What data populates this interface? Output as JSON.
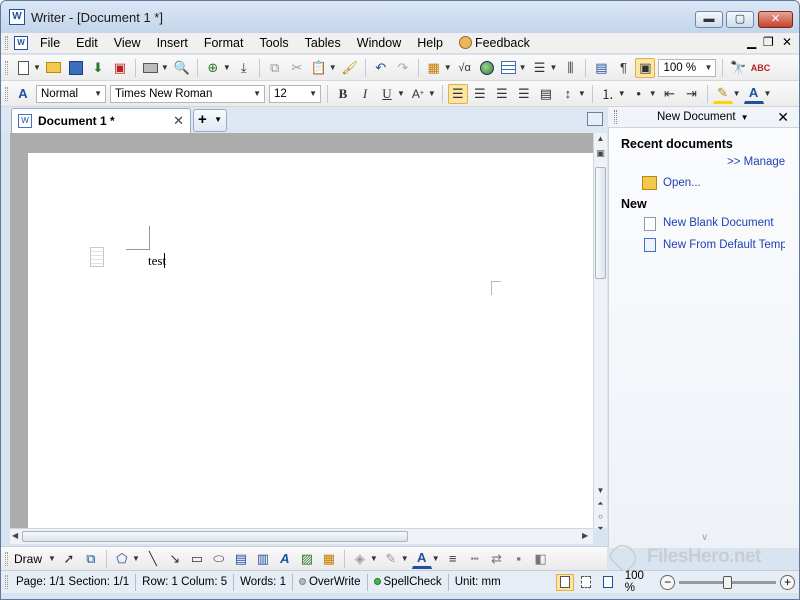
{
  "window": {
    "title": "Writer - [Document 1 *]",
    "app_icon": "W"
  },
  "menu": [
    "File",
    "Edit",
    "View",
    "Insert",
    "Format",
    "Tools",
    "Tables",
    "Window",
    "Help",
    "Feedback"
  ],
  "toolbar": {
    "zoom": "100 %"
  },
  "format": {
    "style": "Normal",
    "font": "Times New Roman",
    "size": "12",
    "bold": "B",
    "italic": "I",
    "underline": "U"
  },
  "tabs": {
    "document": "Document 1 *",
    "new_tab": "+"
  },
  "document": {
    "text": "test"
  },
  "panel": {
    "header": "New Document",
    "recent_heading": "Recent documents",
    "manage": ">> Manage",
    "open": "Open...",
    "new_heading": "New",
    "blank": "New Blank Document",
    "from_template": "New From Default Template"
  },
  "drawbar": {
    "label": "Draw"
  },
  "watermark": "FilesHero.net",
  "status": {
    "page": "Page: 1/1 Section: 1/1",
    "row_col": "Row: 1 Colum: 5",
    "words": "Words: 1",
    "overwrite": "OverWrite",
    "spellcheck": "SpellCheck",
    "unit": "Unit: mm",
    "zoom": "100 %",
    "zoom_level": 0.5
  },
  "colors": {
    "accent": "#2140b4",
    "highlight": "#fbe6a6",
    "title_bg": "#c3d5ea"
  }
}
